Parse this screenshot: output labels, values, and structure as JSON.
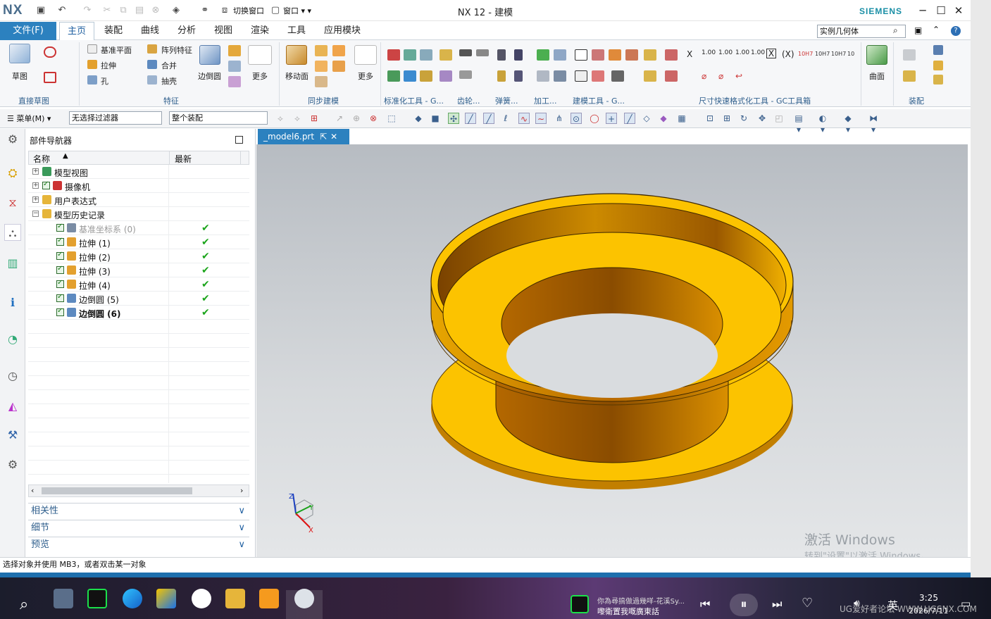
{
  "app": {
    "logo": "NX",
    "title": "NX 12 - 建模",
    "brand": "SIEMENS"
  },
  "menu": {
    "file": "文件(F)",
    "tabs": [
      "主页",
      "装配",
      "曲线",
      "分析",
      "视图",
      "渲染",
      "工具",
      "应用模块"
    ],
    "active_tab": "主页",
    "search": "实例几何体"
  },
  "ribbon": {
    "sketch": "草图",
    "sketch_group": "直接草图",
    "datum_plane": "基准平面",
    "pattern_feature": "阵列特征",
    "extrude": "拉伸",
    "unite": "合并",
    "hole": "孔",
    "shell": "抽壳",
    "edge_blend": "边倒圆",
    "more": "更多",
    "feature_group": "特征",
    "move_face": "移动面",
    "more2": "更多",
    "sync_group": "同步建模",
    "std_tools": "标准化工具 - G...",
    "gear": "齿轮...",
    "spring": "弹簧...",
    "machining": "加工...",
    "modeling_tools": "建模工具 - G...",
    "dim_group": "尺寸快速格式化工具 - GC工具箱",
    "surface": "曲面",
    "assembly": "装配"
  },
  "toolbar2": {
    "menu": "菜单(M)",
    "filter": "无选择过滤器",
    "scope": "整个装配"
  },
  "navigator": {
    "title": "部件导航器",
    "col_name": "名称",
    "col_latest": "最新",
    "rows": [
      {
        "label": "模型视图"
      },
      {
        "label": "摄像机"
      },
      {
        "label": "用户表达式"
      },
      {
        "label": "模型历史记录"
      },
      {
        "label": "基准坐标系 (0)"
      },
      {
        "label": "拉伸 (1)"
      },
      {
        "label": "拉伸 (2)"
      },
      {
        "label": "拉伸 (3)"
      },
      {
        "label": "拉伸 (4)"
      },
      {
        "label": "边倒圆 (5)"
      },
      {
        "label": "边倒圆 (6)"
      }
    ],
    "panels": [
      "相关性",
      "细节",
      "预览"
    ]
  },
  "viewport": {
    "tab": "_model6.prt",
    "axis_x": "X",
    "axis_y": "Y",
    "axis_z": "Z",
    "activate1": "激活 Windows",
    "activate2": "转到\"设置\"以激活 Windows。"
  },
  "status": "选择对象并使用 MB3，或者双击某一对象",
  "taskbar": {
    "song1": "你為尋搞做過幾咩-花溪Sy...",
    "song2": "嚟衛置我嘅廣東話",
    "ime": "英",
    "time": "3:25",
    "date": "2026/7/11",
    "forum": "UG爱好者论坛 WWW.UGSNX.COM"
  },
  "colors": {
    "accent": "#2c81bf",
    "part_light": "#fcc300",
    "part_dark": "#b86a00"
  }
}
